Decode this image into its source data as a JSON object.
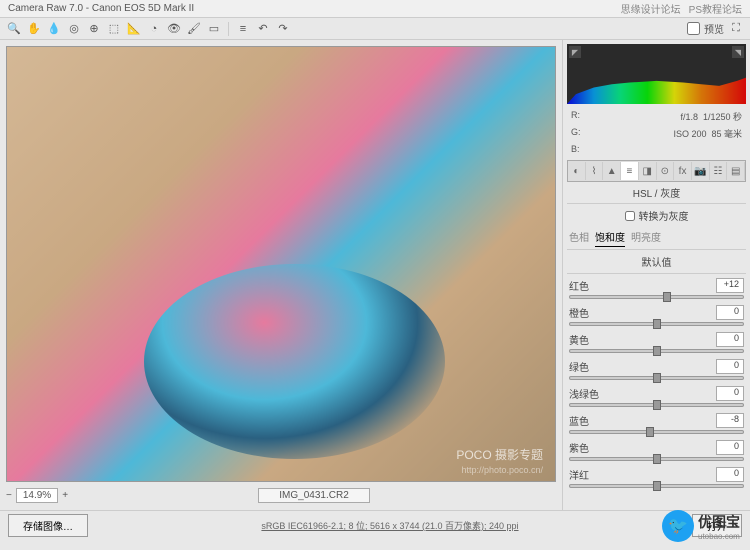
{
  "title": "Camera Raw 7.0 - Canon EOS 5D Mark II",
  "header_right": {
    "a": "思缘设计论坛",
    "b": "PS教程论坛"
  },
  "toolbar": {
    "preview_checkbox": "预览"
  },
  "info": {
    "r_label": "R:",
    "aperture": "f/1.8",
    "shutter": "1/1250 秒",
    "g_label": "G:",
    "iso": "ISO 200",
    "focal": "85 毫米",
    "b_label": "B:"
  },
  "panel": {
    "title": "HSL / 灰度",
    "convert_gray": "转换为灰度",
    "subtabs": {
      "hue": "色相",
      "sat": "饱和度",
      "lum": "明亮度"
    },
    "defaults": "默认值"
  },
  "sliders": [
    {
      "label": "红色",
      "value": "+12",
      "pos": 56
    },
    {
      "label": "橙色",
      "value": "0",
      "pos": 50
    },
    {
      "label": "黄色",
      "value": "0",
      "pos": 50
    },
    {
      "label": "绿色",
      "value": "0",
      "pos": 50
    },
    {
      "label": "浅绿色",
      "value": "0",
      "pos": 50
    },
    {
      "label": "蓝色",
      "value": "-8",
      "pos": 46
    },
    {
      "label": "紫色",
      "value": "0",
      "pos": 50
    },
    {
      "label": "洋红",
      "value": "0",
      "pos": 50
    }
  ],
  "zoom": {
    "value": "14.9%"
  },
  "filename": "IMG_0431.CR2",
  "preview_url": "http://photo.poco.cn/",
  "bottom": {
    "save_btn": "存储图像…",
    "info": "sRGB IEC61966-2.1; 8 位; 5616 x 3744 (21.0 百万像素); 240 ppi",
    "open_btn": "打开"
  },
  "watermark": {
    "name": "优图宝",
    "url": "utobao.com"
  }
}
